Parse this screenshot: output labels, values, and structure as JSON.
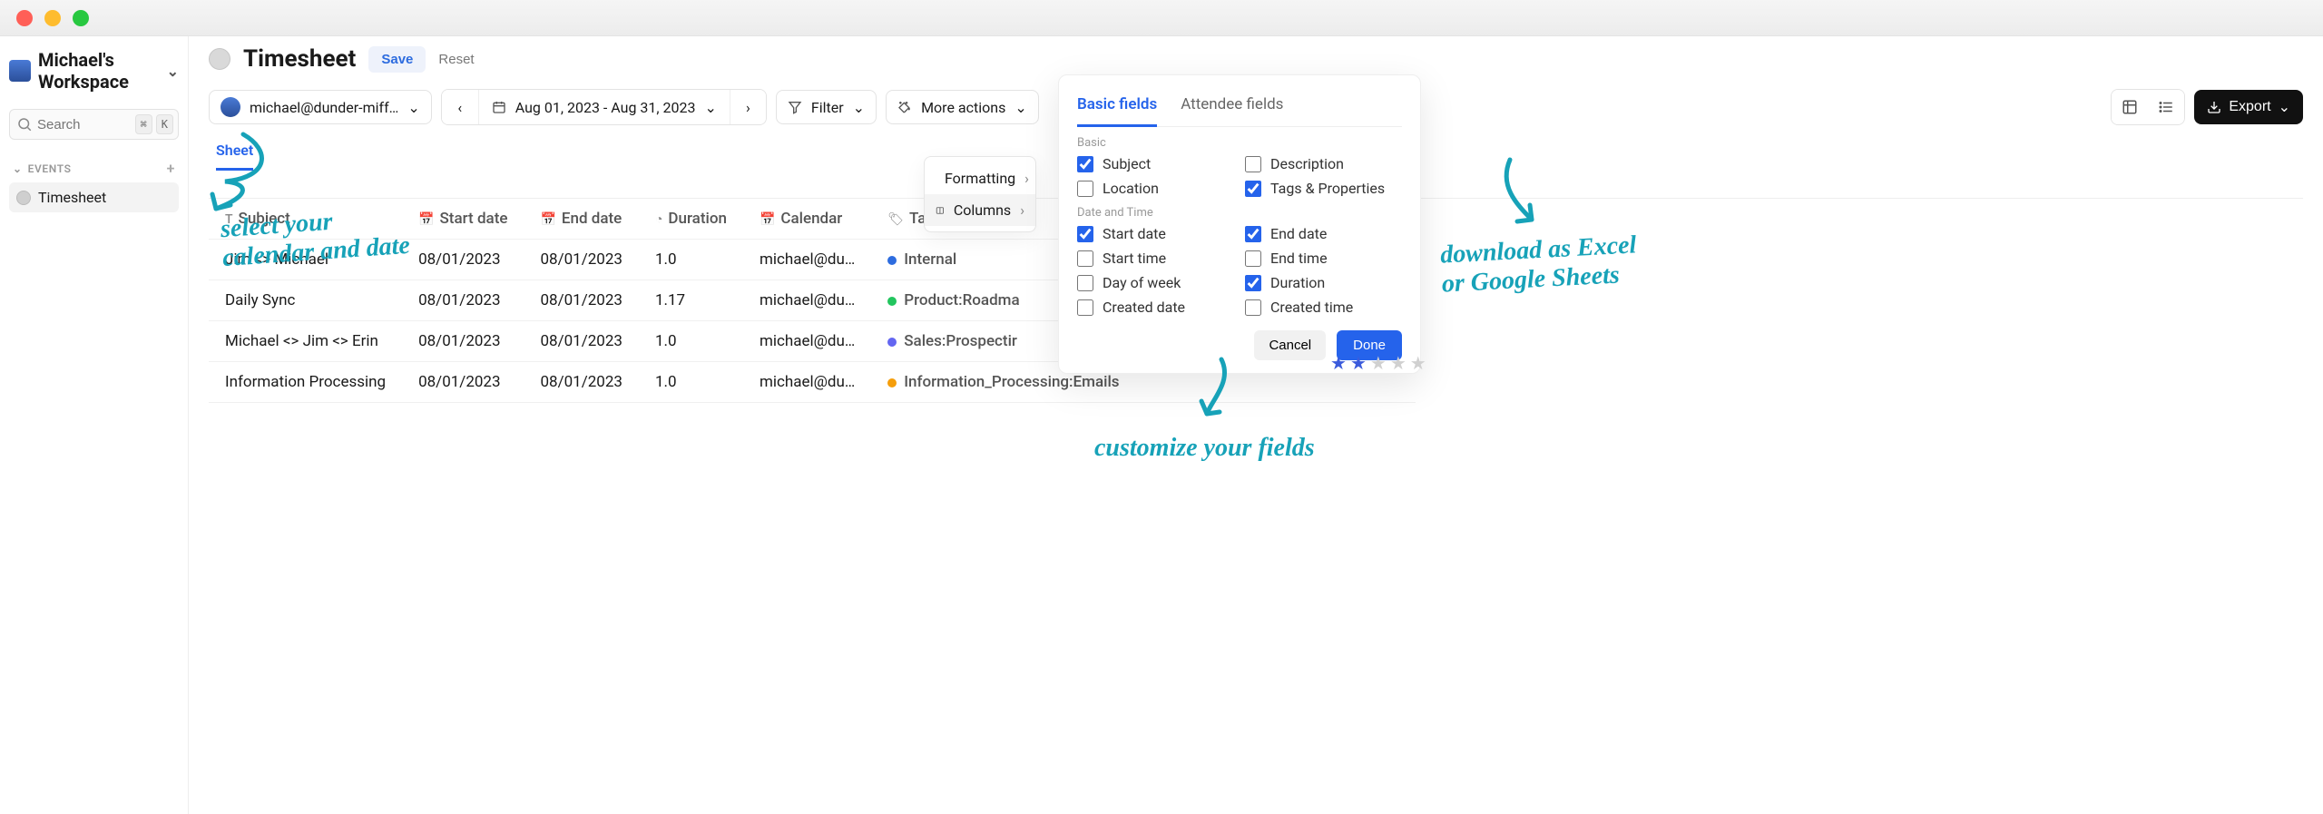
{
  "workspace": {
    "name": "Michael's Workspace"
  },
  "search": {
    "placeholder": "Search",
    "kbd1": "⌘",
    "kbd2": "K"
  },
  "sidebar": {
    "section": "EVENTS",
    "items": [
      {
        "label": "Timesheet"
      }
    ]
  },
  "header": {
    "title": "Timesheet",
    "save": "Save",
    "reset": "Reset"
  },
  "toolbar": {
    "calendar_email": "michael@dunder-miff…",
    "date_range": "Aug 01, 2023 - Aug 31, 2023",
    "filter_label": "Filter",
    "more_actions_label": "More actions",
    "export_label": "Export"
  },
  "tab": {
    "label": "Sheet"
  },
  "columns": {
    "subject": "Subject",
    "start_date": "Start date",
    "end_date": "End date",
    "duration": "Duration",
    "calendar": "Calendar",
    "tags": "Tags"
  },
  "rows": [
    {
      "subject": "Jim <> Michael",
      "start": "08/01/2023",
      "end": "08/01/2023",
      "dur": "1.0",
      "cal": "michael@du…",
      "tag_color": "#2d6cdf",
      "tag": "Internal"
    },
    {
      "subject": "Daily Sync",
      "start": "08/01/2023",
      "end": "08/01/2023",
      "dur": "1.17",
      "cal": "michael@du…",
      "tag_color": "#22c55e",
      "tag": "Product:Roadma"
    },
    {
      "subject": "Michael <> Jim <> Erin",
      "start": "08/01/2023",
      "end": "08/01/2023",
      "dur": "1.0",
      "cal": "michael@du…",
      "tag_color": "#6366f1",
      "tag": "Sales:Prospectir"
    },
    {
      "subject": "Information Processing",
      "start": "08/01/2023",
      "end": "08/01/2023",
      "dur": "1.0",
      "cal": "michael@du…",
      "tag_color": "#f59e0b",
      "tag": "Information_Processing:Emails"
    }
  ],
  "menu": {
    "formatting": "Formatting",
    "columns": "Columns"
  },
  "popover": {
    "tabs": {
      "basic": "Basic fields",
      "attendee": "Attendee fields"
    },
    "grp_basic": "Basic",
    "grp_datetime": "Date and Time",
    "fields": {
      "subject": "Subject",
      "description": "Description",
      "location": "Location",
      "tags": "Tags & Properties",
      "start_date": "Start date",
      "end_date": "End date",
      "start_time": "Start time",
      "end_time": "End time",
      "dow": "Day of week",
      "duration": "Duration",
      "created_date": "Created date",
      "created_time": "Created time"
    },
    "cancel": "Cancel",
    "done": "Done"
  },
  "annotations": {
    "a1_l1": "select your",
    "a1_l2": "calendar and date",
    "a2": "customize your fields",
    "a3_l1": "download as Excel",
    "a3_l2": "or Google Sheets"
  }
}
